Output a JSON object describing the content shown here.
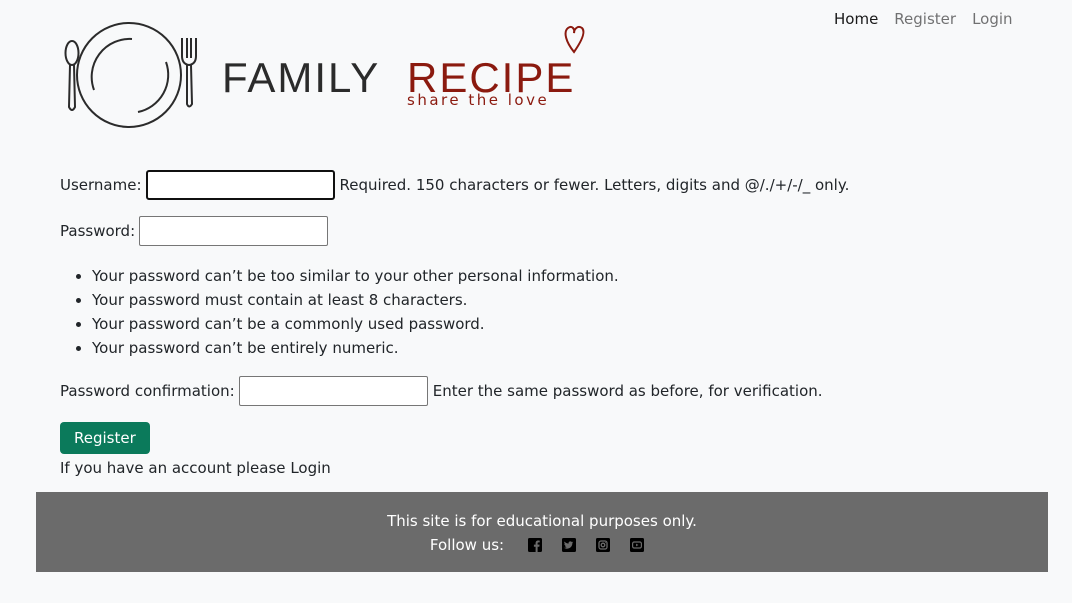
{
  "brand": {
    "name_left": "FAMILY",
    "name_right": "RECIPE",
    "tagline": "share the love",
    "colors": {
      "dark": "#2b2b2b",
      "accent": "#8b1a0f"
    }
  },
  "nav": {
    "items": [
      {
        "label": "Home",
        "active": true
      },
      {
        "label": "Register",
        "active": false
      },
      {
        "label": "Login",
        "active": false
      }
    ]
  },
  "form": {
    "username": {
      "label": "Username:",
      "value": "",
      "help": "Required. 150 characters or fewer. Letters, digits and @/./+/-/_ only."
    },
    "password": {
      "label": "Password:",
      "value": ""
    },
    "password_rules": [
      "Your password can’t be too similar to your other personal information.",
      "Your password must contain at least 8 characters.",
      "Your password can’t be a commonly used password.",
      "Your password can’t be entirely numeric."
    ],
    "password_confirmation": {
      "label": "Password confirmation:",
      "value": "",
      "help": "Enter the same password as before, for verification."
    },
    "submit_label": "Register",
    "account_prompt": "If you have an account please",
    "account_link": "Login"
  },
  "footer": {
    "note": "This site is for educational purposes only.",
    "follow_label": "Follow us:",
    "social_icons": [
      "facebook-icon",
      "twitter-icon",
      "instagram-icon",
      "youtube-icon"
    ],
    "background": "#6b6b6b"
  },
  "colors": {
    "page_bg": "#f8f9fa",
    "button_bg": "#0b7a5b"
  }
}
